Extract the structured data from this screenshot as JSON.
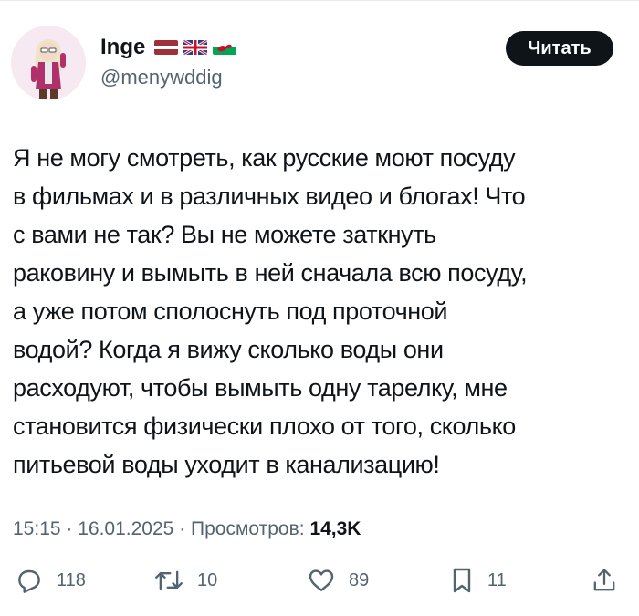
{
  "user": {
    "name": "Inge",
    "handle": "@menywddig",
    "flags": [
      "latvia-flag-icon",
      "uk-flag-icon",
      "wales-flag-icon"
    ],
    "follow_label": "Читать"
  },
  "tweet": {
    "lines": [
      "Я не могу смотреть, как русские моют посуду",
      "в фильмах и в различных видео и блогах! Что",
      "с вами не так? Вы не можете заткнуть",
      "раковину и вымыть в ней сначала всю посуду,",
      "а уже потом сполоснуть под проточной",
      "водой? Когда я вижу сколько воды они",
      "расходуют, чтобы вымыть одну тарелку, мне",
      "становится физически плохо от того, сколько",
      "питьевой воды уходит в канализацию!"
    ]
  },
  "meta": {
    "time": "15:15",
    "date": "16.01.2025",
    "views_label": "Просмотров:",
    "views_count": "14,3K"
  },
  "actions": {
    "replies": "118",
    "reposts": "10",
    "likes": "89",
    "bookmarks": "11"
  },
  "colors": {
    "text": "#0f1419",
    "secondary": "#536471",
    "button_bg": "#0f1419"
  }
}
